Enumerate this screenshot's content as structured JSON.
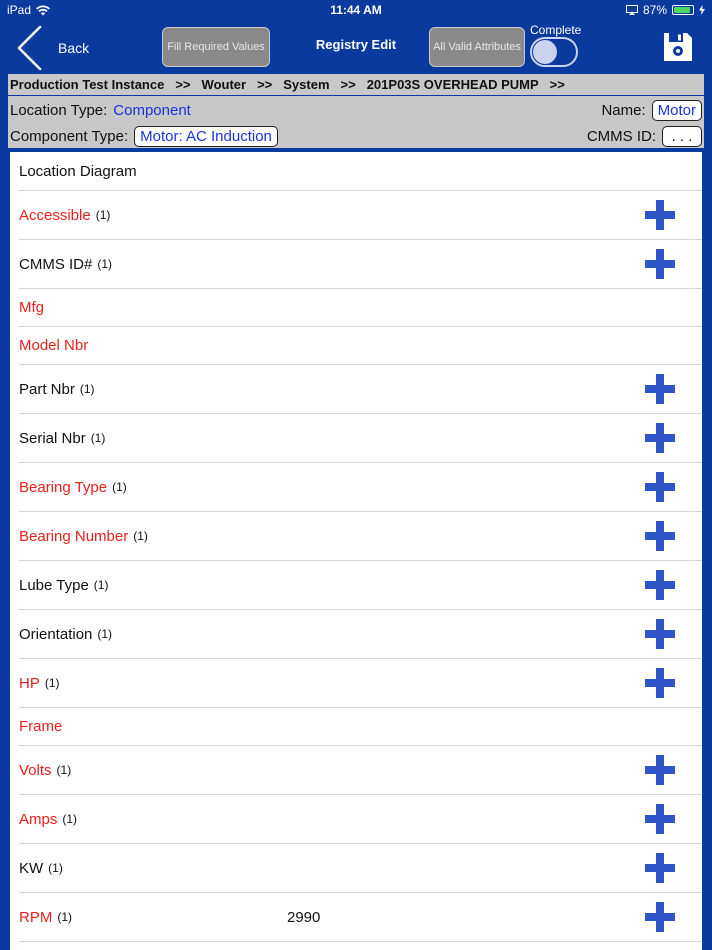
{
  "status_bar": {
    "device": "iPad",
    "time": "11:44 AM",
    "battery_pct": "87%",
    "battery_level": 0.87
  },
  "nav": {
    "back_label": "Back",
    "fill_required_label": "Fill Required Values",
    "title": "Registry Edit",
    "all_valid_label": "All Valid Attributes",
    "complete_label": "Complete",
    "complete_on": false
  },
  "breadcrumb": [
    "Production Test Instance",
    "Wouter",
    "System",
    "201P03S OVERHEAD PUMP"
  ],
  "breadcrumb_sep": ">>",
  "info": {
    "location_type_label": "Location Type:",
    "location_type_value": "Component",
    "name_label": "Name:",
    "name_value": "Motor",
    "component_type_label": "Component Type:",
    "component_type_value": "Motor: AC Induction",
    "cmms_id_label": "CMMS ID:",
    "cmms_id_value": ". . ."
  },
  "rows": [
    {
      "label": "Location Diagram",
      "required": false,
      "count": "",
      "value": "",
      "addable": false
    },
    {
      "label": "Accessible",
      "required": true,
      "count": "(1)",
      "value": "",
      "addable": true
    },
    {
      "label": "CMMS ID#",
      "required": false,
      "count": "(1)",
      "value": "",
      "addable": true
    },
    {
      "label": "Mfg",
      "required": true,
      "count": "",
      "value": "",
      "addable": false
    },
    {
      "label": "Model Nbr",
      "required": true,
      "count": "",
      "value": "",
      "addable": false
    },
    {
      "label": "Part Nbr",
      "required": false,
      "count": "(1)",
      "value": "",
      "addable": true
    },
    {
      "label": "Serial Nbr",
      "required": false,
      "count": "(1)",
      "value": "",
      "addable": true
    },
    {
      "label": "Bearing Type",
      "required": true,
      "count": "(1)",
      "value": "",
      "addable": true
    },
    {
      "label": "Bearing Number",
      "required": true,
      "count": "(1)",
      "value": "",
      "addable": true
    },
    {
      "label": "Lube Type",
      "required": false,
      "count": "(1)",
      "value": "",
      "addable": true
    },
    {
      "label": "Orientation",
      "required": false,
      "count": "(1)",
      "value": "",
      "addable": true
    },
    {
      "label": "HP",
      "required": true,
      "count": "(1)",
      "value": "",
      "addable": true
    },
    {
      "label": "Frame",
      "required": true,
      "count": "",
      "value": "",
      "addable": false
    },
    {
      "label": "Volts",
      "required": true,
      "count": "(1)",
      "value": "",
      "addable": true
    },
    {
      "label": "Amps",
      "required": true,
      "count": "(1)",
      "value": "",
      "addable": true
    },
    {
      "label": "KW",
      "required": false,
      "count": "(1)",
      "value": "",
      "addable": true
    },
    {
      "label": "RPM",
      "required": true,
      "count": "(1)",
      "value": "2990",
      "addable": true
    }
  ],
  "colors": {
    "nav_bg": "#0b3a9e",
    "required_text": "#e8211f",
    "link_text": "#1a33dd",
    "plus_icon": "#2f55c8"
  }
}
